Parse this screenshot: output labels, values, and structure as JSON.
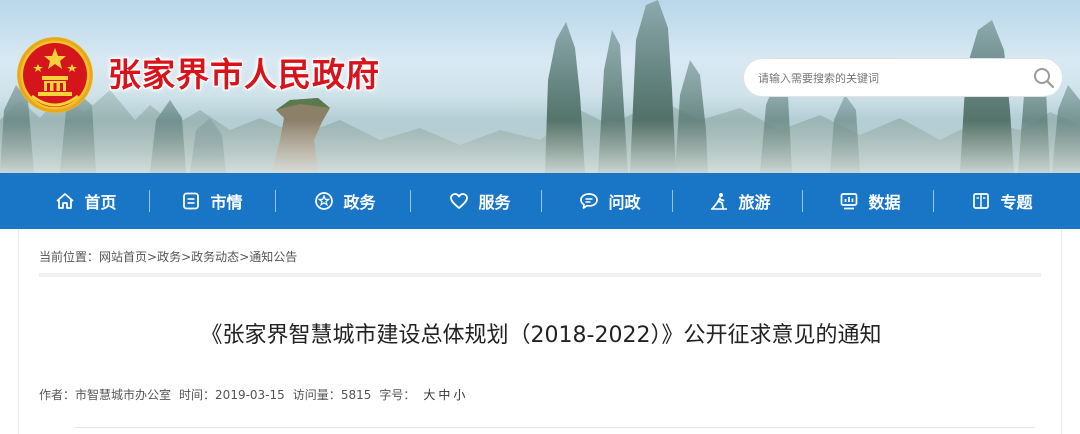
{
  "header": {
    "site_title": "张家界市人民政府",
    "emblem_icon": "national-emblem-icon",
    "search": {
      "placeholder": "请输入需要搜索的关键词",
      "icon": "search-icon"
    }
  },
  "nav": {
    "items": [
      {
        "label": "首页",
        "icon": "home-icon"
      },
      {
        "label": "市情",
        "icon": "document-icon"
      },
      {
        "label": "政务",
        "icon": "government-icon"
      },
      {
        "label": "服务",
        "icon": "heart-icon"
      },
      {
        "label": "问政",
        "icon": "chat-icon"
      },
      {
        "label": "旅游",
        "icon": "travel-icon"
      },
      {
        "label": "数据",
        "icon": "chart-icon"
      },
      {
        "label": "专题",
        "icon": "book-icon"
      }
    ]
  },
  "breadcrumb": {
    "prefix": "当前位置：",
    "items": [
      "网站首页",
      "政务",
      "政务动态",
      "通知公告"
    ],
    "separator": ">"
  },
  "article": {
    "title": "《张家界智慧城市建设总体规划（2018-2022）》公开征求意见的通知",
    "author_label": "作者：",
    "author": "市智慧城市办公室",
    "time_label": "时间：",
    "time": "2019-03-15",
    "views_label": "访问量：",
    "views": "5815",
    "font_label": "字号：",
    "font_sizes": [
      "大",
      "中",
      "小"
    ]
  },
  "colors": {
    "nav_bg": "#1976c7",
    "title_red": "#d8131b"
  }
}
